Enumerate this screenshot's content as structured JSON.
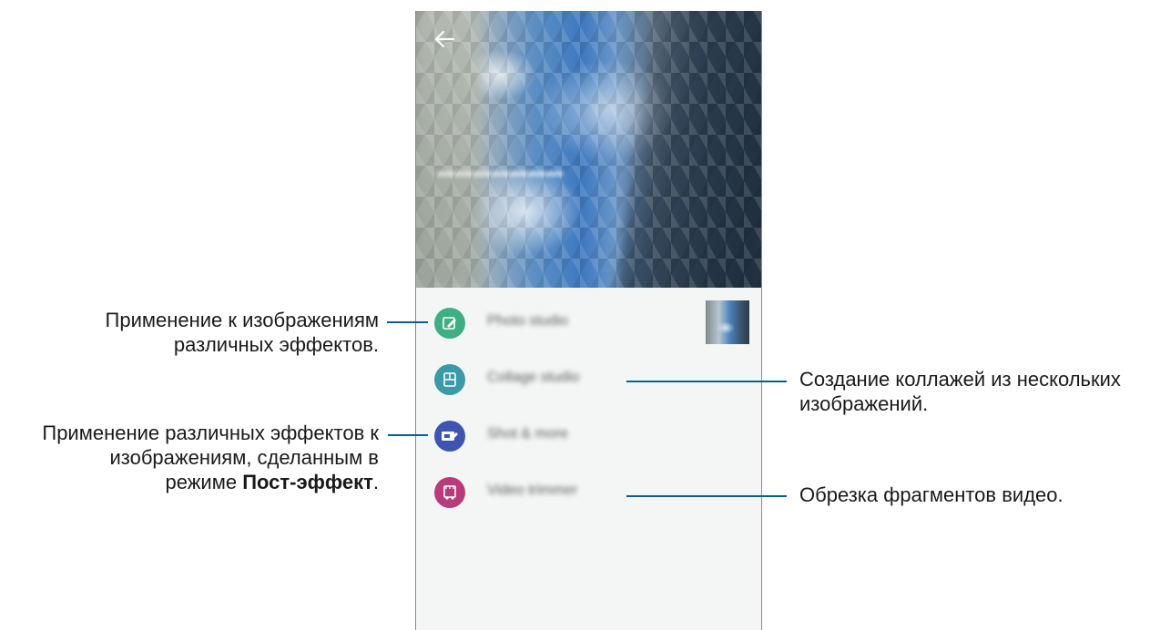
{
  "screen": {
    "back_icon": "arrow-left-icon",
    "menu": [
      {
        "label": "Photo studio",
        "icon": "photo-edit-icon",
        "color": "#3eaf84"
      },
      {
        "label": "Collage studio",
        "icon": "collage-icon",
        "color": "#3a9aa8"
      },
      {
        "label": "Shot & more",
        "icon": "shot-more-icon",
        "color": "#3e54b0"
      },
      {
        "label": "Video trimmer",
        "icon": "video-trim-icon",
        "color": "#b93c7a"
      }
    ]
  },
  "callouts": {
    "photo_studio": {
      "line1": "Применение к изображениям",
      "line2": "различных эффектов."
    },
    "shot_more": {
      "line1": "Применение различных эффектов к",
      "line2": "изображениям, сделанным в",
      "line3_prefix": "режиме ",
      "line3_bold": "Пост-эффект",
      "line3_suffix": "."
    },
    "collage_studio": {
      "line1": "Создание коллажей из нескольких",
      "line2": "изображений."
    },
    "video_trimmer": {
      "line1": "Обрезка фрагментов видео."
    }
  },
  "colors": {
    "callout_line": "#0b5f8c"
  }
}
